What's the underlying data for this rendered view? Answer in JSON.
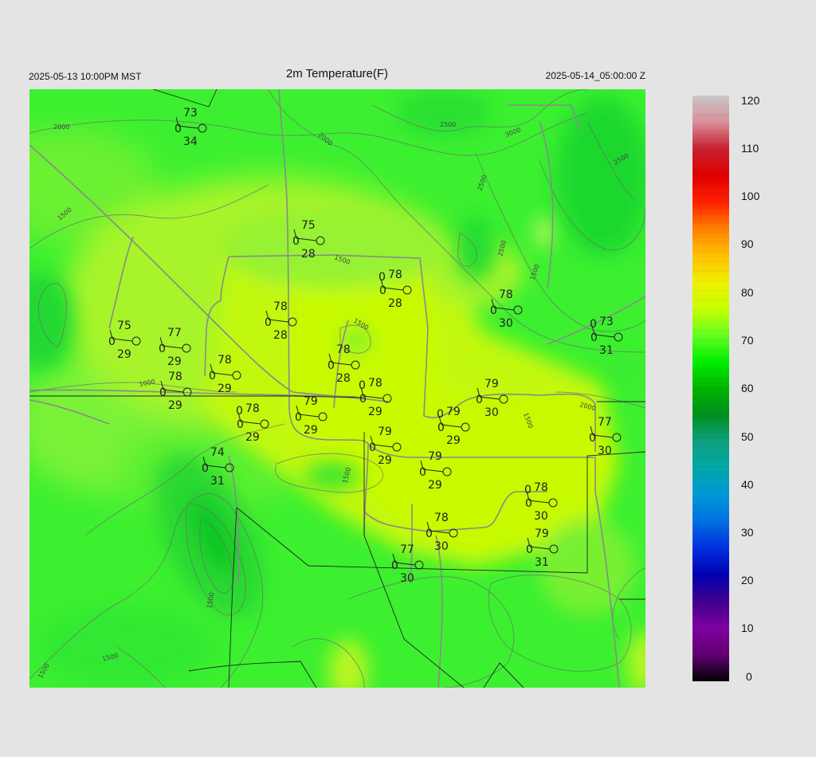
{
  "header": {
    "left": "2025-05-13 10:00PM MST",
    "title": "2m Temperature(F)",
    "right": "2025-05-14_05:00:00 Z"
  },
  "colorbar": {
    "labels": [
      "120",
      "110",
      "100",
      "90",
      "80",
      "70",
      "60",
      "50",
      "40",
      "30",
      "20",
      "10",
      "0"
    ],
    "colors": [
      "#c8c8c8",
      "#d8909a",
      "#c82030",
      "#e00000",
      "#ff2000",
      "#ff8000",
      "#ffc000",
      "#f0f000",
      "#c8ff00",
      "#64ff20",
      "#00ee00",
      "#00b400",
      "#009020",
      "#10a080",
      "#00a8a8",
      "#0098d8",
      "#0070e0",
      "#0030e0",
      "#0000b0",
      "#400090",
      "#8000a0",
      "#600070",
      "#000000"
    ]
  },
  "contour_labels": [
    "2000",
    "2000",
    "2500",
    "3000",
    "2500",
    "2500",
    "2500",
    "1500",
    "1500",
    "1500",
    "1000",
    "1500",
    "1500",
    "1500",
    "2000",
    "1500",
    "1500",
    "1500"
  ],
  "stations": [
    {
      "t": "73",
      "d": "34",
      "f": ""
    },
    {
      "t": "75",
      "d": "28",
      "f": ""
    },
    {
      "t": "78",
      "d": "28",
      "f": "0"
    },
    {
      "t": "78",
      "d": "30",
      "f": ""
    },
    {
      "t": "75",
      "d": "29",
      "f": ""
    },
    {
      "t": "77",
      "d": "29",
      "f": ""
    },
    {
      "t": "78",
      "d": "28",
      "f": ""
    },
    {
      "t": "78",
      "d": "28",
      "f": ""
    },
    {
      "t": "73",
      "d": "31",
      "f": "0"
    },
    {
      "t": "78",
      "d": "29",
      "f": ""
    },
    {
      "t": "78",
      "d": "29",
      "f": ""
    },
    {
      "t": "78",
      "d": "29",
      "f": "0"
    },
    {
      "t": "79",
      "d": "29",
      "f": ""
    },
    {
      "t": "79",
      "d": "30",
      "f": ""
    },
    {
      "t": "78",
      "d": "29",
      "f": "0"
    },
    {
      "t": "79",
      "d": "29",
      "f": "0"
    },
    {
      "t": "79",
      "d": "29",
      "f": ""
    },
    {
      "t": "77",
      "d": "30",
      "f": ""
    },
    {
      "t": "74",
      "d": "31",
      "f": ""
    },
    {
      "t": "79",
      "d": "29",
      "f": ""
    },
    {
      "t": "78",
      "d": "30",
      "f": "0"
    },
    {
      "t": "78",
      "d": "30",
      "f": ""
    },
    {
      "t": "79",
      "d": "31",
      "f": ""
    },
    {
      "t": "77",
      "d": "30",
      "f": ""
    }
  ]
}
